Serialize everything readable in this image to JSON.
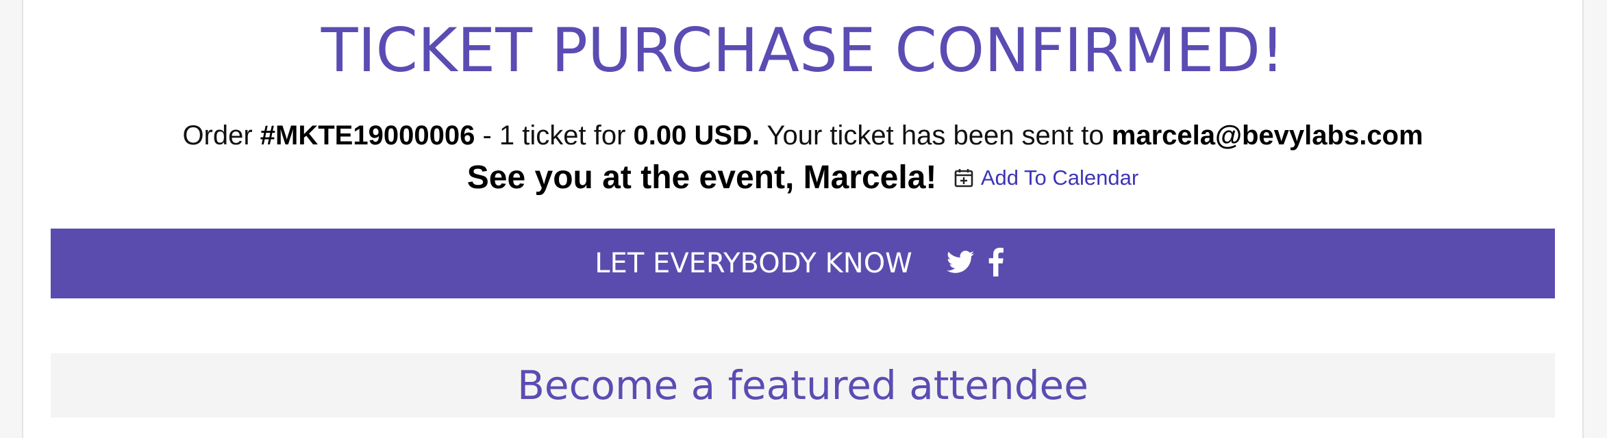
{
  "confirmation": {
    "title": "TICKET PURCHASE CONFIRMED!",
    "order_prefix": "Order ",
    "order_number": "#MKTE19000006",
    "ticket_text": " - 1 ticket for ",
    "amount": "0.00 USD.",
    "sent_text": " Your ticket has been sent to ",
    "email": "marcela@bevylabs.com",
    "greeting": "See you at the event, Marcela!",
    "calendar_label": "Add To Calendar",
    "calendar_icon": "calendar-plus-icon"
  },
  "share": {
    "label": "LET EVERYBODY KNOW",
    "icons": [
      "twitter-icon",
      "facebook-icon"
    ]
  },
  "featured": {
    "title": "Become a featured attendee"
  },
  "colors": {
    "accent": "#5a4cb3",
    "share_bar": "#5a4caf",
    "link": "#3d34b7",
    "featured_bg": "#f4f4f4"
  }
}
